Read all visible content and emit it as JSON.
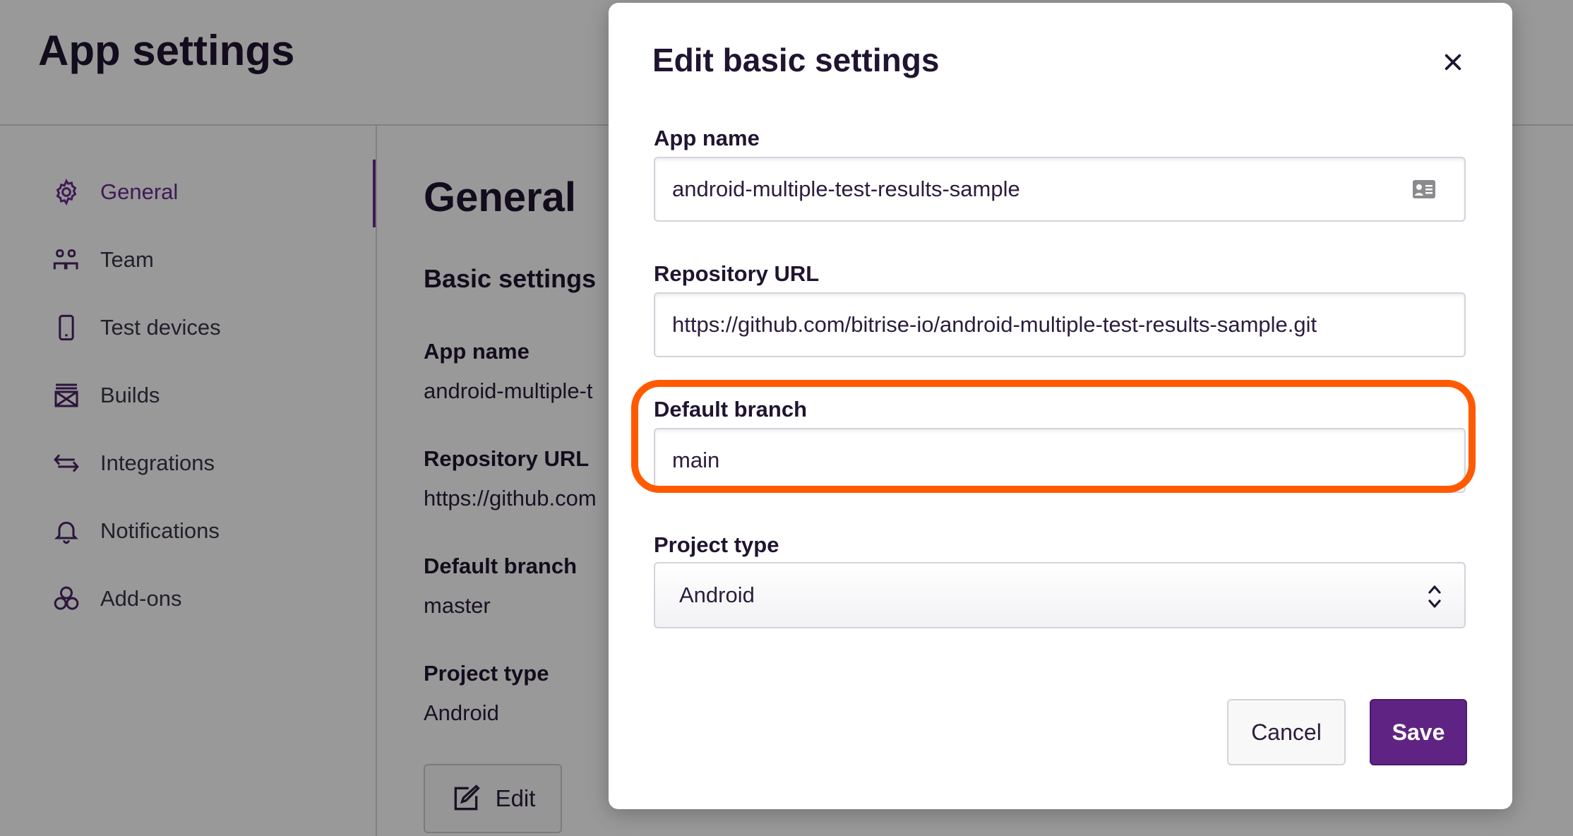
{
  "page": {
    "title": "App settings"
  },
  "sidebar": {
    "items": [
      {
        "label": "General",
        "icon": "gear-icon",
        "active": true
      },
      {
        "label": "Team",
        "icon": "team-icon"
      },
      {
        "label": "Test devices",
        "icon": "phone-icon"
      },
      {
        "label": "Builds",
        "icon": "builds-icon"
      },
      {
        "label": "Integrations",
        "icon": "arrows-icon"
      },
      {
        "label": "Notifications",
        "icon": "bell-icon"
      },
      {
        "label": "Add-ons",
        "icon": "addons-icon"
      }
    ]
  },
  "main": {
    "title": "General",
    "subtitle": "Basic settings",
    "fields": [
      {
        "label": "App name",
        "value": "android-multiple-t"
      },
      {
        "label": "Repository URL",
        "value": "https://github.com"
      },
      {
        "label": "Default branch",
        "value": "master"
      },
      {
        "label": "Project type",
        "value": "Android"
      }
    ],
    "edit_label": "Edit"
  },
  "modal": {
    "title": "Edit basic settings",
    "app_name_label": "App name",
    "app_name_value": "android-multiple-test-results-sample",
    "repo_url_label": "Repository URL",
    "repo_url_value": "https://github.com/bitrise-io/android-multiple-test-results-sample.git",
    "default_branch_label": "Default branch",
    "default_branch_value": "main",
    "project_type_label": "Project type",
    "project_type_value": "Android",
    "cancel_label": "Cancel",
    "save_label": "Save"
  },
  "colors": {
    "accent": "#6b2c91",
    "save_button": "#5f2483",
    "highlight": "#ff5a00"
  }
}
